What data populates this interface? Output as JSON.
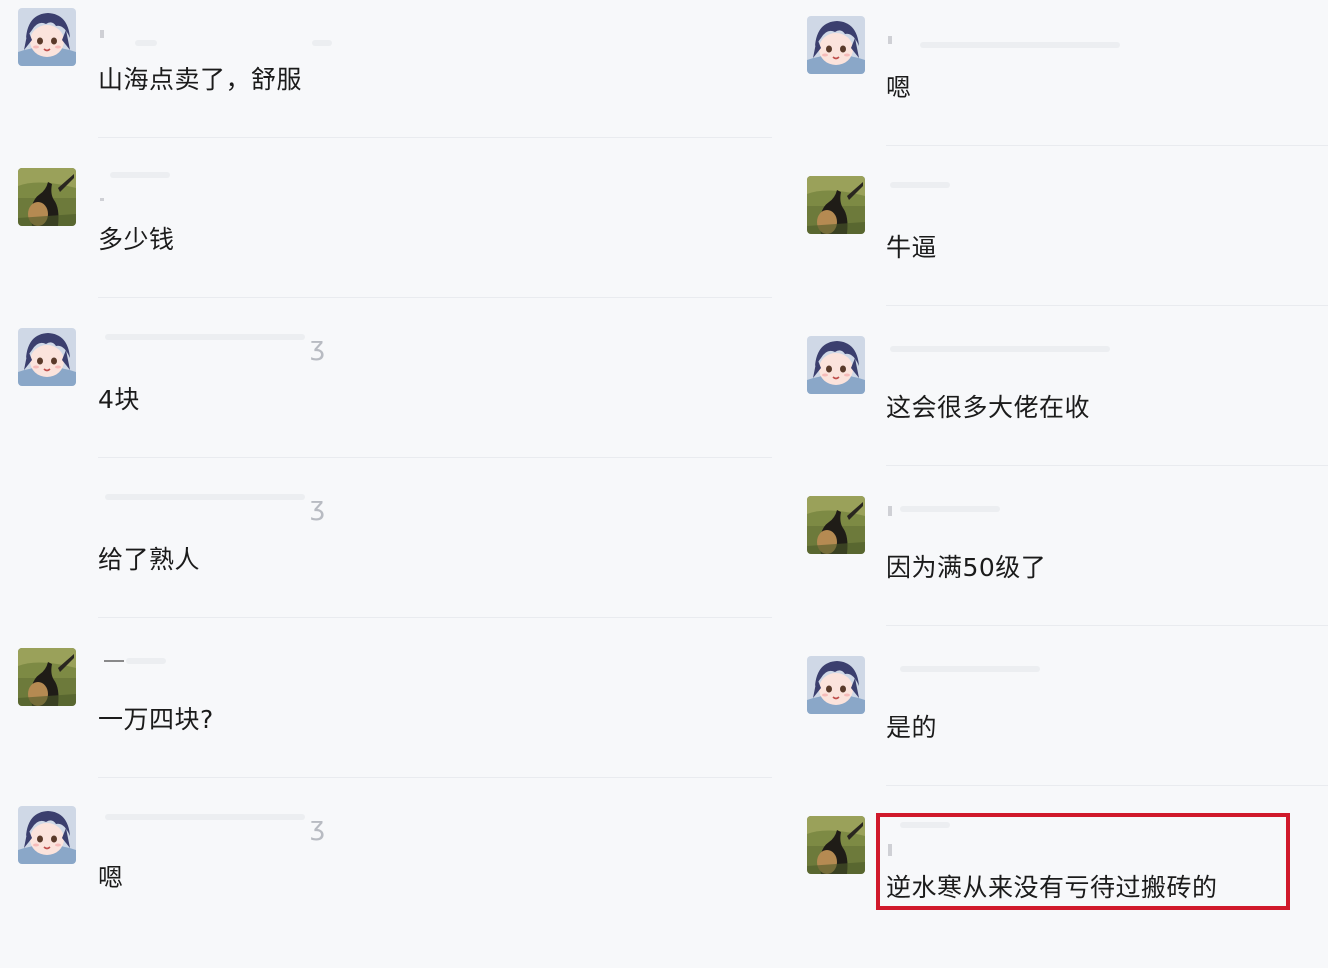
{
  "chat": {
    "left_column": [
      {
        "avatar": "anime-avatar",
        "message": "山海点卖了，舒服"
      },
      {
        "avatar": "landscape-avatar",
        "message": "多少钱"
      },
      {
        "avatar": "anime-avatar",
        "message": "4块"
      },
      {
        "avatar": "",
        "message": "给了熟人"
      },
      {
        "avatar": "landscape-avatar",
        "message": "一万四块?"
      },
      {
        "avatar": "anime-avatar",
        "message": "嗯"
      }
    ],
    "right_column": [
      {
        "avatar": "anime-avatar",
        "message": "嗯"
      },
      {
        "avatar": "landscape-avatar",
        "message": "牛逼"
      },
      {
        "avatar": "anime-avatar",
        "message": "这会很多大佬在收"
      },
      {
        "avatar": "landscape-avatar",
        "message": "因为满50级了"
      },
      {
        "avatar": "anime-avatar",
        "message": "是的"
      },
      {
        "avatar": "landscape-avatar",
        "message": "逆水寒从来没有亏待过搬砖的"
      }
    ]
  },
  "colors": {
    "highlight": "#d0192b",
    "background": "#f7f8fa",
    "text": "#1b1b1b"
  }
}
